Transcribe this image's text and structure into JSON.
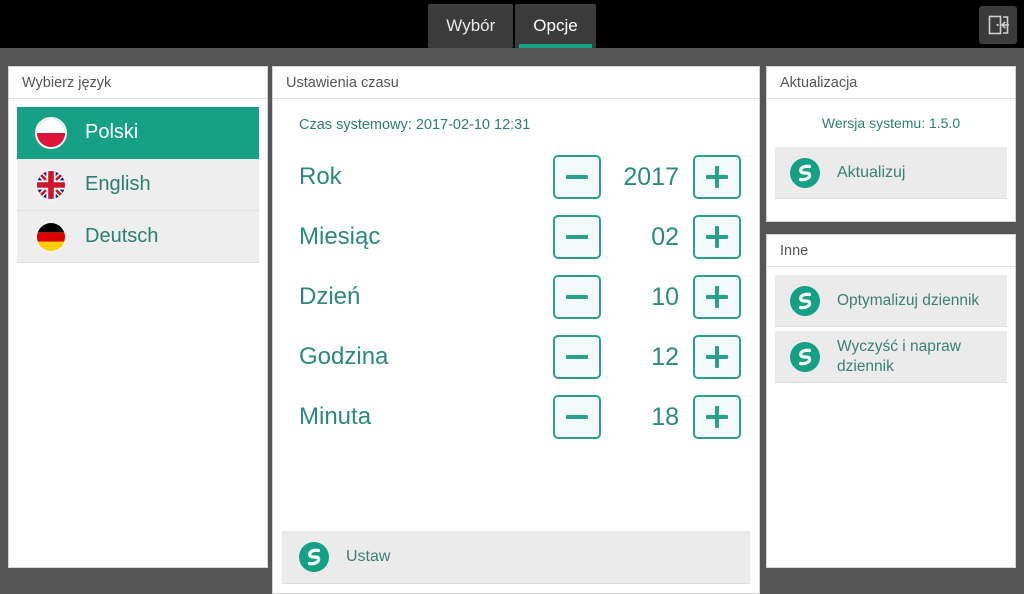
{
  "window": {
    "tabs": [
      {
        "label": "Wybór",
        "active": false
      },
      {
        "label": "Opcje",
        "active": true
      }
    ],
    "exit_icon": "exit-door-icon",
    "accent_color": "#16a085",
    "topbar_color": "#000000",
    "workspace_color": "#565656"
  },
  "language_panel": {
    "header": "Wybierz język",
    "items": [
      {
        "label": "Polski",
        "flag": "flag-poland",
        "selected": true
      },
      {
        "label": "English",
        "flag": "flag-united-kingdom",
        "selected": false
      },
      {
        "label": "Deutsch",
        "flag": "flag-germany",
        "selected": false
      }
    ]
  },
  "time_panel": {
    "header": "Ustawienia czasu",
    "system_time": "Czas systemowy: 2017-02-10 12:31",
    "minus_icon": "minus-icon",
    "plus_icon": "plus-icon",
    "rows": [
      {
        "label": "Rok",
        "value": "2017"
      },
      {
        "label": "Miesiąc",
        "value": "02"
      },
      {
        "label": "Dzień",
        "value": "10"
      },
      {
        "label": "Godzina",
        "value": "12"
      },
      {
        "label": "Minuta",
        "value": "18"
      }
    ],
    "set_button": {
      "label": "Ustaw",
      "icon": "refresh-swirl-icon"
    }
  },
  "update_panel": {
    "header": "Aktualizacja",
    "system_version": "Wersja systemu: 1.5.0",
    "button": {
      "label": "Aktualizuj",
      "icon": "refresh-swirl-icon"
    }
  },
  "other_panel": {
    "header": "Inne",
    "items": [
      {
        "label": "Optymalizuj dziennik",
        "icon": "refresh-swirl-icon"
      },
      {
        "label": "Wyczyść i napraw dziennik",
        "icon": "refresh-swirl-icon"
      }
    ]
  }
}
